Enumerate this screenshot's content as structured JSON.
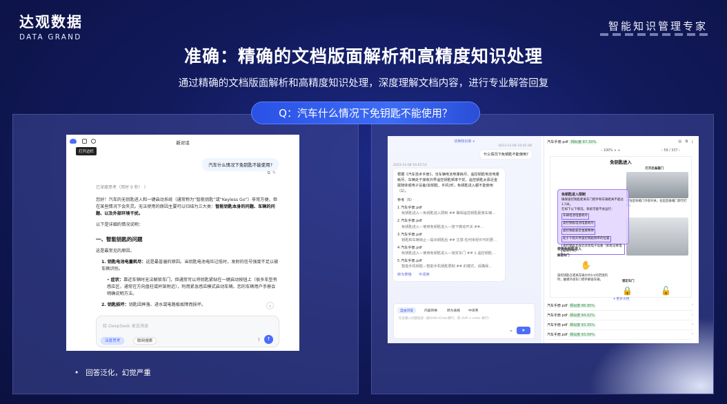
{
  "brand": {
    "name_cn": "达观数据",
    "name_en": "DATA GRAND"
  },
  "tagline": "智能知识管理专家",
  "title": "准确：精确的文档版面解析和高精度知识处理",
  "subtitle": "通过精确的文档版面解析和高精度知识处理，深度理解文档内容，进行专业解答回复",
  "question": "Q：汽车什么情况下免钥匙不能使用？",
  "left_shot": {
    "tooltip": "打开边栏",
    "chat_title": "新对话",
    "user_message": "汽车什么情况下免钥匙不能使用?",
    "thinking": "已深度思考（用时 9 秒） 〉",
    "intro": "您好！汽车的无钥匙进入和一键启动系统（通常称为“智能钥匙”或“Keyless Go”）非常方便，但在某些情况下会失灵。无法使用的原因主要可以归结为三大类：",
    "intro_bold": "智能钥匙本身的问题、车辆的问题、以及外部环境干扰。",
    "detail_lead": "以下是详细的情况说明：",
    "section_heading": "一、智能钥匙的问题",
    "common_reason": "这是最常见的原因。",
    "item1_bold": "1. 钥匙电池电量耗尽：",
    "item1_text": "这是最普遍的原因。当钥匙电池电压过低时，发射的信号强度不足以被车辆识别。",
    "sub_bold": "症状：",
    "sub_text": "靠近车辆时无法解锁车门，但通常可以将钥匙紧贴在一键启动按钮上（很多车型有感应区，通常在方向盘柱或杯架附近），利用紧急感应模式启动车辆。您的车辆用户手册会明确说明方法。",
    "item2_bold": "2. 钥匙损坏：",
    "item2_text": "钥匙因摔落、进水或电路板故障而损坏。",
    "input_placeholder": "给 DeepSeek 发送消息",
    "chip_deep": "深度思考",
    "chip_search": "联网搜索"
  },
  "bullet_note": "回答泛化，幻觉严重",
  "right_shot": {
    "kb_switch": "切换知识库 ∨",
    "time1": "2023-12-08 16:02:48",
    "user_message": "什么情况下免钥匙不能使用?",
    "time2": "2023-12-08 16:02:53",
    "answer": "根据《汽车技术手册》，当车辆电池电量耗尽、遥控钥匙电池电量耗尽、车辆处于接收外界遥控钥匙频率干扰、遥控钥匙太靠近金属物体或电子设备(如钥匙、手机)时，免钥匙进入都不能使用（1）。",
    "ref_header": "参考（5）",
    "refs": [
      {
        "doc": "1 汽车手册.pdf",
        "snip": "免钥匙进入—免钥匙进入限制 ## 确保遥控钥匙距离车辆..."
      },
      {
        "doc": "2 汽车手册.pdf",
        "snip": "免钥匙进入—使用免钥匙进入—按下微动开关 ##..."
      },
      {
        "doc": "3 汽车手册.pdf",
        "snip": "钥匙和车辆锁止—提出钥匙后 ## 注意:任何未经许可的更..."
      },
      {
        "doc": "4 汽车手册.pdf",
        "snip": "免钥匙进入—使用免钥匙进入—锁定车门 ## 1.遥控钥匙..."
      },
      {
        "doc": "5 汽车手册.pdf",
        "snip": "智能手机钥匙—智能手机钥匙限制 ## 的模式，请确保..."
      }
    ],
    "actions": "转为表格　　中译英",
    "tabs": [
      "自由问答",
      "内容转换",
      "转为表格",
      "中译英"
    ],
    "input_placeholder": "在此输入问题描述（按Shift+Enter换行，或 shift + enter 换行）",
    "doc_name": "汽车手册.pdf",
    "doc_sim": "相似度 87.30%",
    "zoom": "100%",
    "page": "59 / 337",
    "page_title": "免钥匙进入",
    "hl_title": "免钥匙进入限制",
    "hl_text": "确保遥控钥匙距离车门把手和车辆距离不超过1.5米。",
    "hl_lead": "在如下以下情况，系统可能不会运行：",
    "hl_items": [
      "车辆电池电量耗尽",
      "遥控钥匙电池电量耗尽",
      "遥控钥匙靠近金属物体",
      "处于干扰外界遥控钥匙频率的位置",
      "遥控钥匙太靠近其他电子设备（如笔记本电脑或手机）"
    ],
    "use_heading": "使用免钥匙进入",
    "unlock_label": "解锁车门",
    "lock_label": "锁定车门",
    "open_trunk": "打开后备箱门",
    "photo_caption": "按住后背箱门外部开关，拉起后备箱门即可打开。",
    "unlock_text": "遥控钥匙在距离车辆大约1m的范围内时，触摸外部车门把手解锁车辆。",
    "lock_text": "遥控钥匙在距离车辆大约1m的范围内时，按下车门把手上的微动开关。",
    "more_docs": "更多文档",
    "doc_list": [
      {
        "name": "汽车手册.pdf",
        "sim": "相似度 86.95%"
      },
      {
        "name": "汽车手册.pdf",
        "sim": "相似度 84.02%"
      },
      {
        "name": "汽车手册.pdf",
        "sim": "相似度 83.35%"
      },
      {
        "name": "汽车手册.pdf",
        "sim": "相似度 83.09%"
      }
    ]
  }
}
